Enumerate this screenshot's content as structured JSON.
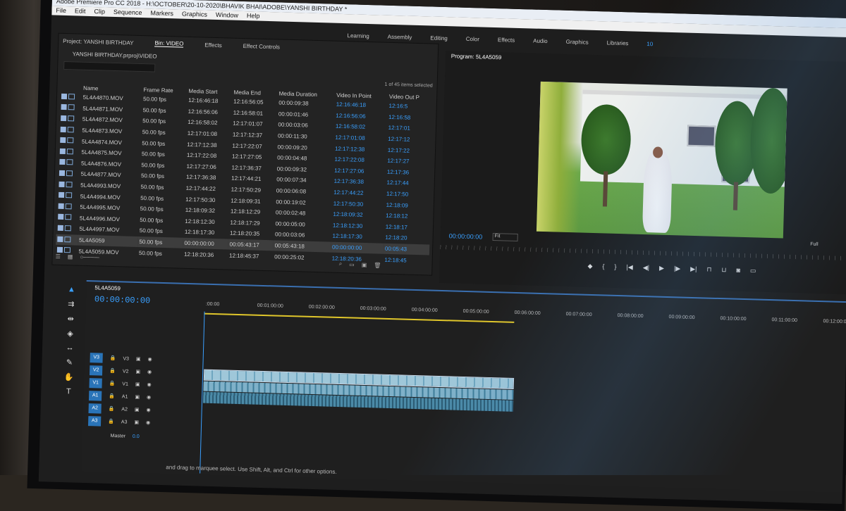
{
  "window": {
    "title": "Adobe Premiere Pro CC 2018 - H:\\OCTOBER\\20-10-2020\\BHAVIK BHAI\\ADOBE\\YANSHI BIRTHDAY *"
  },
  "menu": [
    "File",
    "Edit",
    "Clip",
    "Sequence",
    "Markers",
    "Graphics",
    "Window",
    "Help"
  ],
  "workspaces": [
    "Learning",
    "Assembly",
    "Editing",
    "Color",
    "Effects",
    "Audio",
    "Graphics",
    "Libraries"
  ],
  "workspace_extra": "10",
  "project": {
    "tabs": [
      "Project: YANSHI BIRTHDAY",
      "Bin: VIDEO",
      "Effects",
      "Effect Controls"
    ],
    "path": "YANSHI BIRTHDAY.prproj\\VIDEO",
    "selection": "1 of 45 items selected",
    "columns": [
      "Name",
      "Frame Rate",
      "Media Start",
      "Media End",
      "Media Duration",
      "Video In Point",
      "Video Out P"
    ],
    "rows": [
      [
        "5L4A4870.MOV",
        "50.00 fps",
        "12:16:46:18",
        "12:16:56:05",
        "00:00:09:38",
        "12:16:46:18",
        "12:16:5"
      ],
      [
        "5L4A4871.MOV",
        "50.00 fps",
        "12:16:56:06",
        "12:16:58:01",
        "00:00:01:46",
        "12:16:56:06",
        "12:16:58"
      ],
      [
        "5L4A4872.MOV",
        "50.00 fps",
        "12:16:58:02",
        "12:17:01:07",
        "00:00:03:06",
        "12:16:58:02",
        "12:17:01"
      ],
      [
        "5L4A4873.MOV",
        "50.00 fps",
        "12:17:01:08",
        "12:17:12:37",
        "00:00:11:30",
        "12:17:01:08",
        "12:17:12"
      ],
      [
        "5L4A4874.MOV",
        "50.00 fps",
        "12:17:12:38",
        "12:17:22:07",
        "00:00:09:20",
        "12:17:12:38",
        "12:17:22"
      ],
      [
        "5L4A4875.MOV",
        "50.00 fps",
        "12:17:22:08",
        "12:17:27:05",
        "00:00:04:48",
        "12:17:22:08",
        "12:17:27"
      ],
      [
        "5L4A4876.MOV",
        "50.00 fps",
        "12:17:27:06",
        "12:17:36:37",
        "00:00:09:32",
        "12:17:27:06",
        "12:17:36"
      ],
      [
        "5L4A4877.MOV",
        "50.00 fps",
        "12:17:36:38",
        "12:17:44:21",
        "00:00:07:34",
        "12:17:36:38",
        "12:17:44"
      ],
      [
        "5L4A4993.MOV",
        "50.00 fps",
        "12:17:44:22",
        "12:17:50:29",
        "00:00:06:08",
        "12:17:44:22",
        "12:17:50"
      ],
      [
        "5L4A4994.MOV",
        "50.00 fps",
        "12:17:50:30",
        "12:18:09:31",
        "00:00:19:02",
        "12:17:50:30",
        "12:18:09"
      ],
      [
        "5L4A4995.MOV",
        "50.00 fps",
        "12:18:09:32",
        "12:18:12:29",
        "00:00:02:48",
        "12:18:09:32",
        "12:18:12"
      ],
      [
        "5L4A4996.MOV",
        "50.00 fps",
        "12:18:12:30",
        "12:18:17:29",
        "00:00:05:00",
        "12:18:12:30",
        "12:18:17"
      ],
      [
        "5L4A4997.MOV",
        "50.00 fps",
        "12:18:17:30",
        "12:18:20:35",
        "00:00:03:06",
        "12:18:17:30",
        "12:18:20"
      ],
      [
        "5L4A5059",
        "50.00 fps",
        "00:00:00:00",
        "00:05:43:17",
        "00:05:43:18",
        "00:00:00:00",
        "00:05:43"
      ],
      [
        "5L4A5059.MOV",
        "50.00 fps",
        "12:18:20:36",
        "12:18:45:37",
        "00:00:25:02",
        "12:18:20:36",
        "12:18:45"
      ]
    ]
  },
  "program": {
    "title": "Program: 5L4A5059",
    "timecode": "00:00:00:00",
    "fit": "Fit",
    "quality": "Full"
  },
  "timeline": {
    "sequence": "5L4A5059",
    "timecode": "00:00:00:00",
    "ruler": [
      ":00:00",
      "00:01:00:00",
      "00:02:00:00",
      "00:03:00:00",
      "00:04:00:00",
      "00:05:00:00",
      "00:06:00:00",
      "00:07:00:00",
      "00:08:00:00",
      "00:09:00:00",
      "00:10:00:00",
      "00:11:00:00",
      "00:12:00:00"
    ],
    "tracks": [
      "V3",
      "V2",
      "V1",
      "A1",
      "A2",
      "A3"
    ],
    "master_label": "Master",
    "master_value": "0.0"
  },
  "status": "and drag to marquee select. Use Shift, Alt, and Ctrl for other options."
}
